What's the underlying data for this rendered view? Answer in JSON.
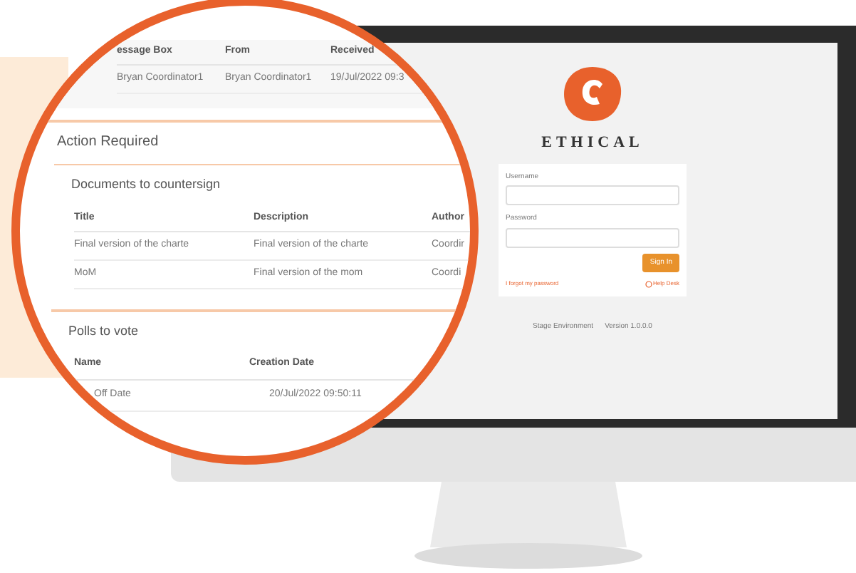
{
  "message_table": {
    "columns": [
      "essage Box",
      "From",
      "Received"
    ],
    "rows": [
      [
        "Bryan Coordinator1",
        "Bryan Coordinator1",
        "19/Jul/2022 09:3"
      ]
    ]
  },
  "action_required": {
    "title": "Action Required"
  },
  "documents": {
    "title": "Documents to countersign",
    "columns": [
      "Title",
      "Description",
      "Author"
    ],
    "rows": [
      [
        "Final version of the charte",
        "Final version of the charte",
        "Coordir"
      ],
      [
        "MoM",
        "Final version of the mom",
        "Coordi"
      ]
    ]
  },
  "polls": {
    "title": "Polls to vote",
    "columns": [
      "Name",
      "Creation Date"
    ],
    "rows": [
      [
        "Off Date",
        "20/Jul/2022 09:50:11"
      ]
    ]
  },
  "login": {
    "brand": "ETHICAL",
    "username_label": "Username",
    "password_label": "Password",
    "sign_in": "Sign In",
    "forgot": "I forgot my password",
    "help": "Help Desk",
    "environment": "Stage Environment",
    "version": "Version 1.0.0.0"
  }
}
